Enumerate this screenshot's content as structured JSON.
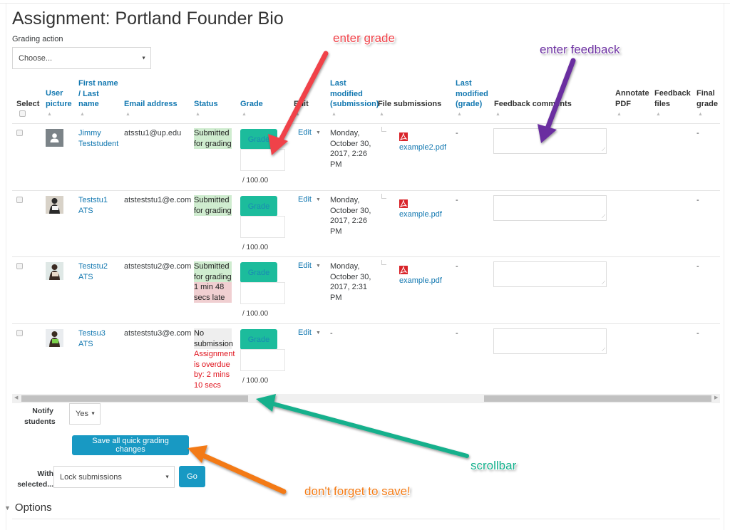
{
  "page": {
    "title": "Assignment: Portland Founder Bio"
  },
  "grading_action": {
    "label": "Grading action",
    "selected": "Choose..."
  },
  "table": {
    "headers": {
      "select": "Select",
      "user_picture": [
        "User",
        "picture"
      ],
      "name": [
        "First name",
        "/ Last",
        "name"
      ],
      "email": "Email address",
      "status": "Status",
      "grade": "Grade",
      "edit": "Edit",
      "last_modified_submission": [
        "Last",
        "modified",
        "(submission)"
      ],
      "file_submissions": "File submissions",
      "last_modified_grade": [
        "Last",
        "modified",
        "(grade)"
      ],
      "feedback_comments": "Feedback comments",
      "annotate_pdf": [
        "Annotate",
        "PDF"
      ],
      "feedback_files": [
        "Feedback",
        "files"
      ],
      "final_grade": [
        "Final",
        "grade"
      ]
    },
    "rows": [
      {
        "name": [
          "Jimmy",
          "Teststudent"
        ],
        "email": "atsstu1@up.edu",
        "status": [
          "Submitted",
          "for grading"
        ],
        "status_late": [],
        "status_overdue": [],
        "grade_button": "Grade",
        "grade_value": "",
        "grade_max": "/ 100.00",
        "edit": "Edit",
        "last_modified": [
          "Monday,",
          "October 30,",
          "2017, 2:26",
          "PM"
        ],
        "file": "example2.pdf",
        "last_modified_grade": "-",
        "feedback": "",
        "final_grade": "-",
        "avatar": "default-user-icon"
      },
      {
        "name": [
          "Teststu1",
          "ATS"
        ],
        "email": "atsteststu1@e.com",
        "status": [
          "Submitted",
          "for grading"
        ],
        "status_late": [],
        "status_overdue": [],
        "grade_button": "Grade",
        "grade_value": "",
        "grade_max": "/ 100.00",
        "edit": "Edit",
        "last_modified": [
          "Monday,",
          "October 30,",
          "2017, 2:26",
          "PM"
        ],
        "file": "example.pdf",
        "last_modified_grade": "-",
        "feedback": "",
        "final_grade": "-",
        "avatar": "photo"
      },
      {
        "name": [
          "Teststu2",
          "ATS"
        ],
        "email": "atsteststu2@e.com",
        "status": [
          "Submitted",
          "for grading"
        ],
        "status_late": [
          "1 min 48",
          "secs late"
        ],
        "status_overdue": [],
        "grade_button": "Grade",
        "grade_value": "",
        "grade_max": "/ 100.00",
        "edit": "Edit",
        "last_modified": [
          "Monday,",
          "October 30,",
          "2017, 2:31",
          "PM"
        ],
        "file": "example.pdf",
        "last_modified_grade": "-",
        "feedback": "",
        "final_grade": "-",
        "avatar": "photo"
      },
      {
        "name": [
          "Testsu3",
          "ATS"
        ],
        "email": "atsteststu3@e.com",
        "status": [
          "No",
          "submission"
        ],
        "status_late": [],
        "status_overdue": [
          "Assignment",
          "is overdue",
          "by: 2 mins",
          "10 secs"
        ],
        "grade_button": "Grade",
        "grade_value": "",
        "grade_max": "/ 100.00",
        "edit": "Edit",
        "last_modified": [
          "-"
        ],
        "file": "",
        "last_modified_grade": "-",
        "feedback": "",
        "final_grade": "-",
        "avatar": "photo"
      }
    ]
  },
  "notify": {
    "label": [
      "Notify",
      "students"
    ],
    "selected": "Yes"
  },
  "save_button": "Save all quick grading changes",
  "with_selected": {
    "label": [
      "With",
      "selected..."
    ],
    "selected": "Lock submissions",
    "go": "Go"
  },
  "options": {
    "label": "Options"
  },
  "annotations": {
    "enter_grade": "enter grade",
    "enter_feedback": "enter feedback",
    "scrollbar": "scrollbar",
    "save_reminder": "don't forget to save!"
  },
  "colors": {
    "link": "#1177b0",
    "grade_button": "#1cbc9c",
    "primary_button": "#1899c3",
    "status_submitted": "#cfeccf",
    "status_late": "#f0cfd1",
    "overdue_text": "#e0141e",
    "anno_red": "#f0434a",
    "anno_purple": "#6b2fa0",
    "anno_green": "#14b08c",
    "anno_orange": "#f37a14"
  }
}
